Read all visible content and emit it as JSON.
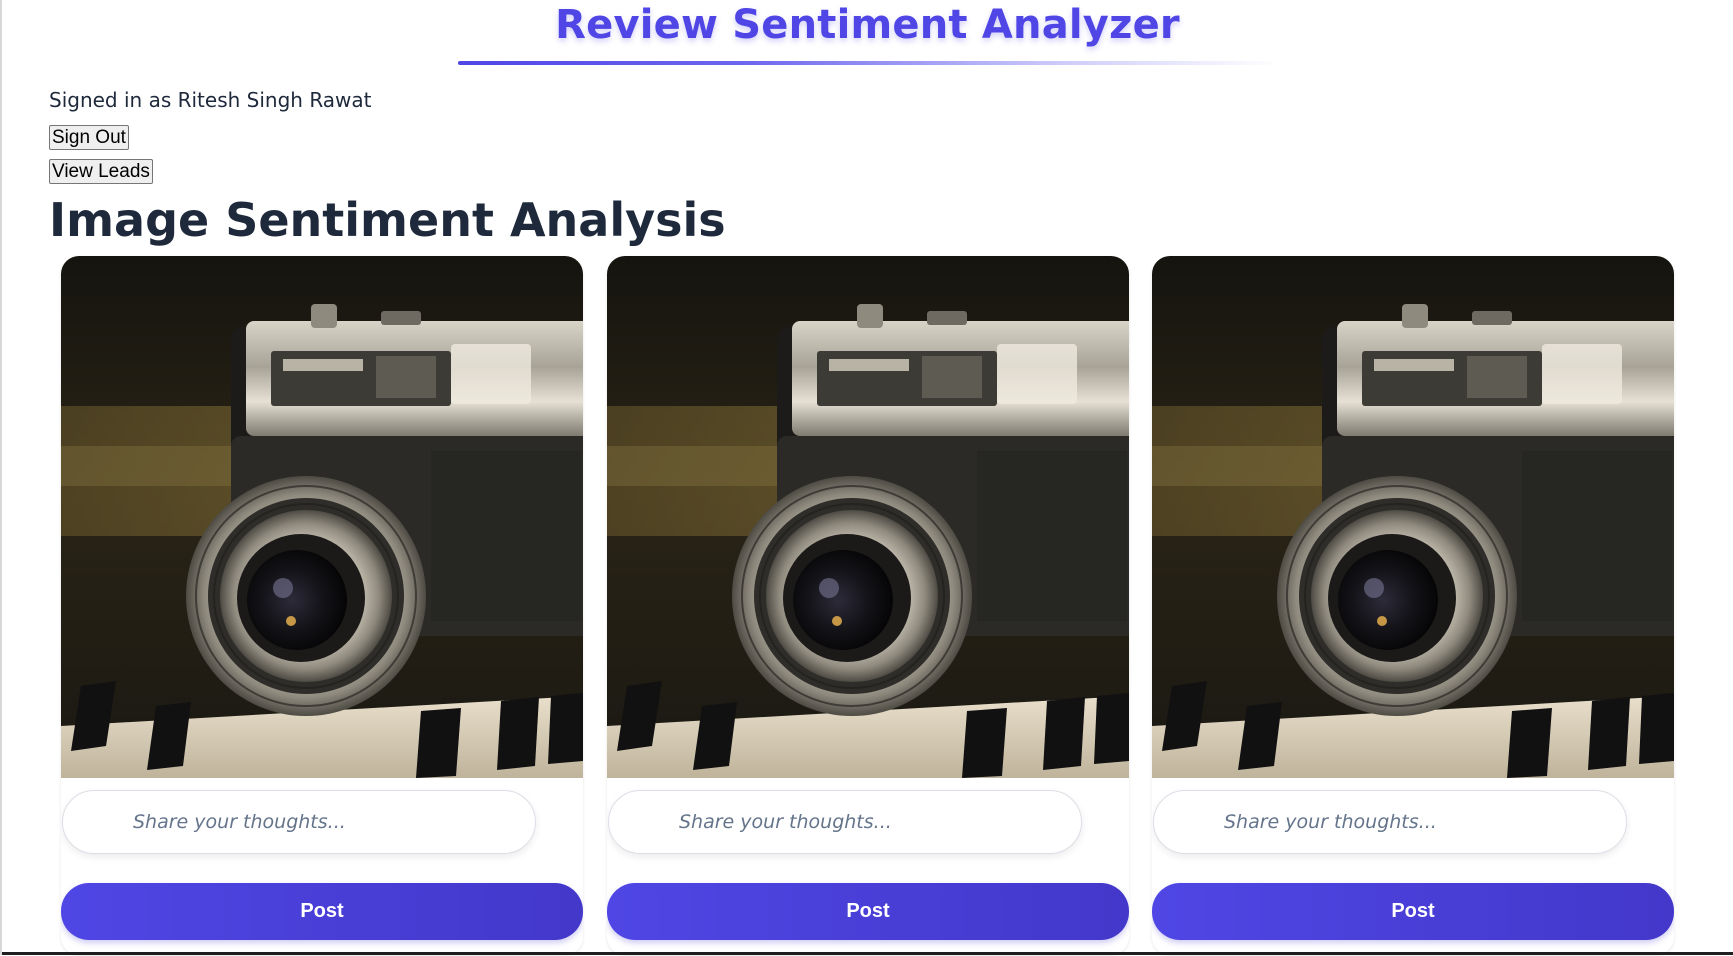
{
  "header": {
    "title": "Review Sentiment Analyzer"
  },
  "user": {
    "signed_in_text": "Signed in as Ritesh Singh Rawat"
  },
  "actions": {
    "sign_out_label": "Sign Out",
    "view_leads_label": "View Leads"
  },
  "section": {
    "heading": "Image Sentiment Analysis"
  },
  "cards": [
    {
      "image": "vintage-camera-photo",
      "input_placeholder": "Share your thoughts...",
      "post_label": "Post"
    },
    {
      "image": "vintage-camera-photo",
      "input_placeholder": "Share your thoughts...",
      "post_label": "Post"
    },
    {
      "image": "vintage-camera-photo",
      "input_placeholder": "Share your thoughts...",
      "post_label": "Post"
    }
  ],
  "colors": {
    "accent": "#4f46e5",
    "accent_dark": "#4338ca",
    "heading_text": "#1e293b"
  }
}
